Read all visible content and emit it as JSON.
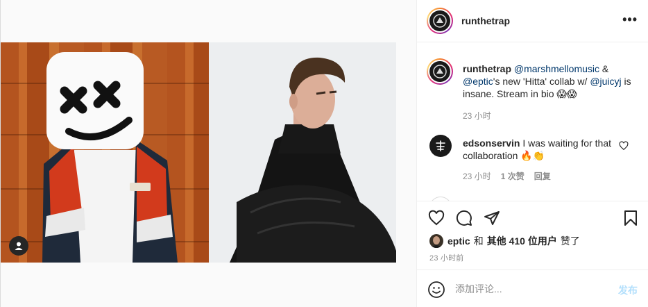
{
  "post": {
    "author": "runthetrap",
    "more_icon": "more-options-icon",
    "caption": {
      "author": "runthetrap",
      "mention_1": "@marshmellomusic",
      "text_1": " & ",
      "mention_2": "@eptic",
      "text_2": "'s new 'Hitta' collab w/ ",
      "mention_3": "@juicyj",
      "text_3": " is insane. Stream in bio 😱😱",
      "time": "23 小时"
    },
    "comments": [
      {
        "author": "edsonservin",
        "text": "I was waiting for that collaboration 🔥👏",
        "time": "23 小时",
        "likes": "1 次赞",
        "reply_label": "回复"
      }
    ],
    "likes": {
      "first_user": "eptic",
      "connector": "和",
      "others": "其他 410 位用户",
      "suffix": "赞了"
    },
    "timestamp": "23 小时前",
    "add_comment": {
      "placeholder": "添加评论...",
      "post_label": "发布"
    }
  },
  "colors": {
    "link": "#00376b",
    "muted": "#8e8e8e",
    "post_button_disabled": "#b2dffc",
    "story_ring": "#dd2a7b"
  },
  "icons": [
    "heart-icon",
    "comment-icon",
    "share-icon",
    "bookmark-icon",
    "emoji-icon",
    "user-tag-icon",
    "small-heart-icon"
  ]
}
